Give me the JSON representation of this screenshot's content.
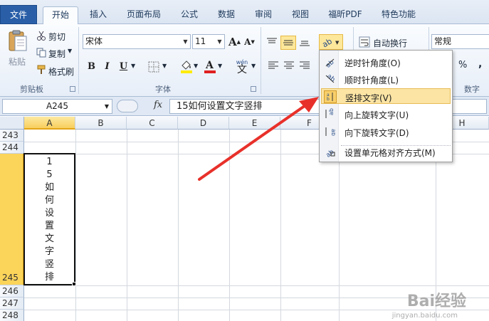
{
  "tabs": [
    {
      "label": "文件"
    },
    {
      "label": "开始"
    },
    {
      "label": "插入"
    },
    {
      "label": "页面布局"
    },
    {
      "label": "公式"
    },
    {
      "label": "数据"
    },
    {
      "label": "审阅"
    },
    {
      "label": "视图"
    },
    {
      "label": "福昕PDF"
    },
    {
      "label": "特色功能"
    }
  ],
  "clipboard": {
    "paste": "粘贴",
    "cut": "剪切",
    "copy": "复制",
    "format_painter": "格式刷",
    "group_label": "剪贴板"
  },
  "font": {
    "name": "宋体",
    "size": "11",
    "group_label": "字体",
    "bold": "B",
    "italic": "I",
    "underline": "U",
    "grow": "A",
    "shrink": "A",
    "wen": "wén",
    "wen_char": "文"
  },
  "alignment": {
    "wrap_text": "自动换行"
  },
  "number": {
    "format": "常规",
    "group_label": "数字",
    "percent": "%",
    "comma": ","
  },
  "formula_bar": {
    "name_box": "A245",
    "fx": "fx",
    "content": "15如何设置文字竖排"
  },
  "columns": [
    "A",
    "B",
    "C",
    "D",
    "E",
    "F",
    "G",
    "H"
  ],
  "rows": [
    "243",
    "244",
    "245",
    "246",
    "247",
    "248"
  ],
  "selected_cell_chars": [
    "1",
    "5",
    "如",
    "何",
    "设",
    "置",
    "文",
    "字",
    "竖",
    "排"
  ],
  "orientation_menu": {
    "items": [
      {
        "label": "逆时针角度(O)"
      },
      {
        "label": "顺时针角度(L)"
      },
      {
        "label": "竖排文字(V)"
      },
      {
        "label": "向上旋转文字(U)"
      },
      {
        "label": "向下旋转文字(D)"
      },
      {
        "label": "设置单元格对齐方式(M)"
      }
    ],
    "highlighted_index": 2
  },
  "watermark": {
    "brand": "Bai经验",
    "url": "jingyan.baidu.com"
  },
  "colors": {
    "file_tab": "#2a5fa8",
    "selection_header": "#fbd45a",
    "menu_hover": "#fbe4a4",
    "arrow": "#e8302a",
    "font_color": "#e02020",
    "highlight_color": "#ffeb00"
  }
}
